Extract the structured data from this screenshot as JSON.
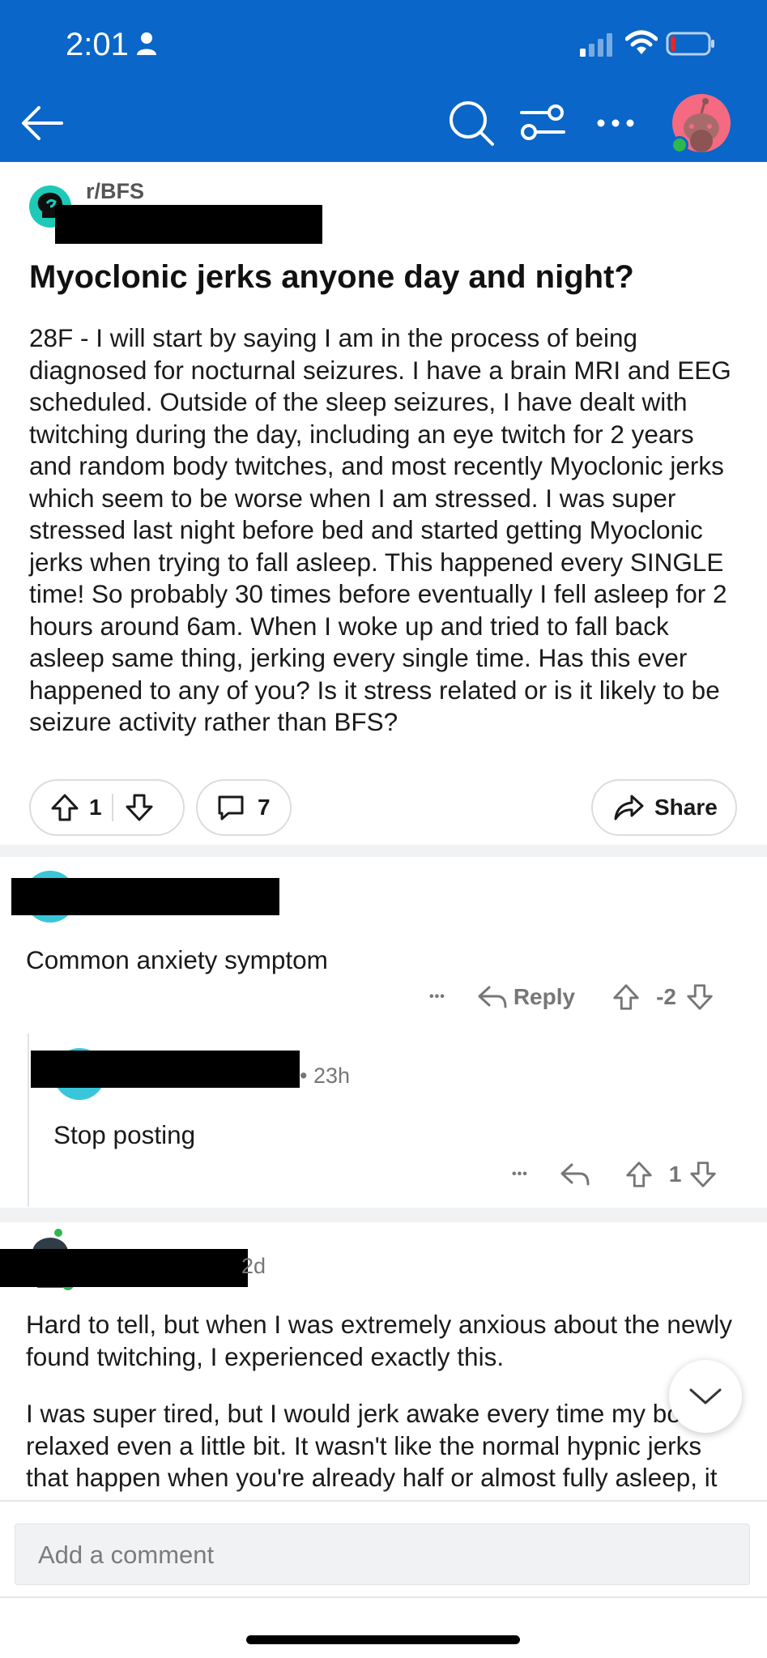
{
  "status_bar": {
    "time": "2:01"
  },
  "post": {
    "subreddit": "r/BFS",
    "title": "Myoclonic jerks anyone day and night?",
    "body": "28F - I will start by saying I am in the process of being diagnosed for nocturnal seizures. I have a brain MRI and EEG scheduled. Outside of the sleep seizures, I have dealt with twitching during the day, including an eye twitch for 2 years and random body twitches,  and most recently Myoclonic jerks which seem to be worse when I am stressed. I was super stressed last night before bed and started getting Myoclonic jerks when trying to fall asleep. This happened every SINGLE time! So probably 30 times before eventually I fell asleep for 2 hours around 6am. When I woke up and tried to fall back asleep same thing, jerking every single time. Has this ever happened to any of you? Is it stress related or is it likely to be seizure activity rather than BFS?",
    "upvotes": "1",
    "comments": "7",
    "share_label": "Share"
  },
  "comments": [
    {
      "text": "Common anxiety symptom",
      "reply_label": "Reply",
      "score": "-2",
      "more": "•••"
    },
    {
      "time": "• 23h",
      "text": "Stop posting",
      "score": "1",
      "more": "•••"
    },
    {
      "time": "2d",
      "text_p1": "Hard to tell, but when I was extremely anxious about the newly found twitching, I experienced exactly this.",
      "text_p2": "I was super tired, but I would jerk awake every time my body relaxed even a little bit. It wasn't like the normal hypnic jerks that happen when you're already half or almost fully asleep, it was every time I would start to fall"
    }
  ],
  "comment_input": {
    "placeholder": "Add a comment"
  },
  "colors": {
    "header": "#0a66c8",
    "accent": "#1ec9b8",
    "avatar": "#f56a80"
  }
}
